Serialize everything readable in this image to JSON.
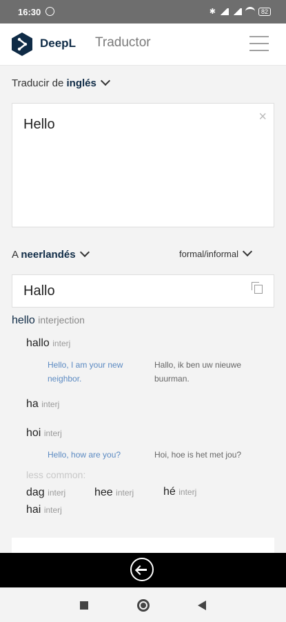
{
  "status": {
    "time": "16:30",
    "battery": "82"
  },
  "header": {
    "brand": "DeepL",
    "subtitle": "Traductor",
    "logo_icon": "deepl-logo-icon",
    "menu_icon": "hamburger-menu-icon"
  },
  "source": {
    "label_prefix": "Traducir de",
    "language": "inglés",
    "text": "Hello",
    "clear_icon": "close-icon"
  },
  "target": {
    "label_prefix": "A",
    "language": "neerlandés",
    "formality": "formal/informal",
    "text": "Hallo",
    "copy_icon": "copy-icon"
  },
  "dictionary": {
    "headword": "hello",
    "headword_pos": "interjection",
    "entries": [
      {
        "word": "hallo",
        "pos": "interj",
        "example_src": "Hello, I am your new neighbor.",
        "example_tgt": "Hallo, ik ben uw nieuwe buurman."
      },
      {
        "word": "ha",
        "pos": "interj"
      },
      {
        "word": "hoi",
        "pos": "interj",
        "example_src": "Hello, how are you?",
        "example_tgt": "Hoi, hoe is het met jou?"
      }
    ],
    "less_common_label": "less common:",
    "less_common": [
      {
        "word": "dag",
        "pos": "interj"
      },
      {
        "word": "hee",
        "pos": "interj"
      },
      {
        "word": "hé",
        "pos": "interj"
      },
      {
        "word": "hai",
        "pos": "interj"
      }
    ]
  },
  "colors": {
    "brand": "#0f2b46",
    "link": "#5b8ac2",
    "status_bar": "#6e6e6e"
  }
}
